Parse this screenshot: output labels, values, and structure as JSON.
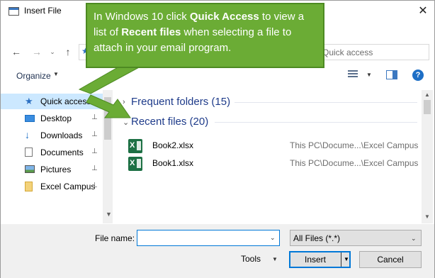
{
  "window": {
    "title": "Insert File",
    "close_glyph": "✕"
  },
  "nav": {
    "back_glyph": "←",
    "forward_glyph": "→",
    "recent_glyph": "⌄",
    "up_glyph": "↑",
    "address_icon": "star-icon",
    "search_placeholder": "Quick access"
  },
  "toolbar": {
    "organize_label": "Organize",
    "caret": "▼",
    "help_glyph": "?"
  },
  "sidebar": {
    "items": [
      {
        "label": "Quick access",
        "icon": "star-icon",
        "pinned": false,
        "selected": true
      },
      {
        "label": "Desktop",
        "icon": "desktop-icon",
        "pinned": true,
        "selected": false
      },
      {
        "label": "Downloads",
        "icon": "download-icon",
        "pinned": true,
        "selected": false
      },
      {
        "label": "Documents",
        "icon": "documents-icon",
        "pinned": true,
        "selected": false
      },
      {
        "label": "Pictures",
        "icon": "pictures-icon",
        "pinned": true,
        "selected": false
      },
      {
        "label": "Excel Campus",
        "icon": "folder-icon",
        "pinned": true,
        "selected": false
      }
    ],
    "pin_glyph": "📌"
  },
  "main": {
    "groups": [
      {
        "label": "Frequent folders (15)",
        "expanded": false
      },
      {
        "label": "Recent files (20)",
        "expanded": true
      }
    ],
    "files": [
      {
        "name": "Book2.xlsx",
        "path": "This PC\\Docume...\\Excel Campus",
        "icon": "excel-file-icon"
      },
      {
        "name": "Book1.xlsx",
        "path": "This PC\\Docume...\\Excel Campus",
        "icon": "excel-file-icon"
      }
    ]
  },
  "bottom": {
    "filename_label": "File name:",
    "filename_value": "",
    "filter_value": "All Files (*.*)",
    "tools_label": "Tools",
    "insert_label": "Insert",
    "cancel_label": "Cancel"
  },
  "callout": {
    "parts": [
      {
        "text": "In Windows 10 click ",
        "bold": false
      },
      {
        "text": "Quick Access",
        "bold": true
      },
      {
        "text": " to view a list of ",
        "bold": false
      },
      {
        "text": "Recent files",
        "bold": true
      },
      {
        "text": " when selecting a file to attach in your email program.",
        "bold": false
      }
    ]
  },
  "colors": {
    "callout_bg": "#6bac35",
    "selected_bg": "#cce8ff",
    "group_text": "#1e3b8a",
    "accent": "#0078d7"
  }
}
